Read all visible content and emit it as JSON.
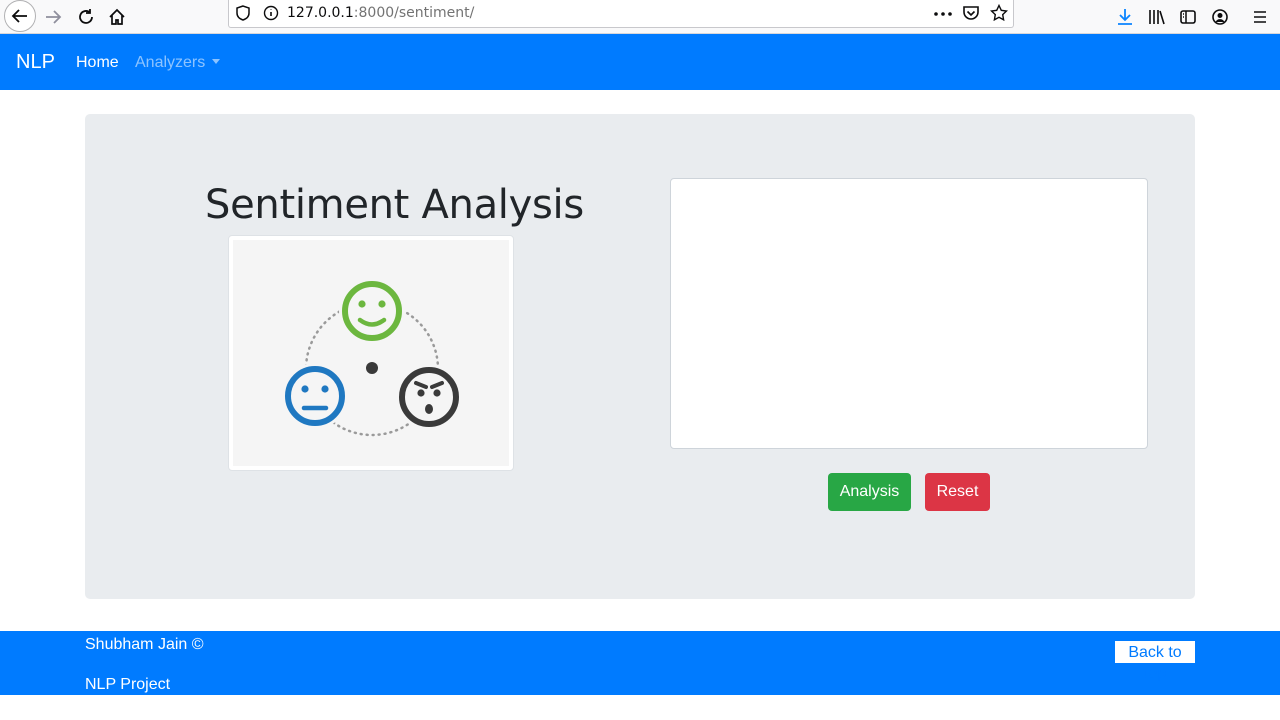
{
  "browser": {
    "url_host": "127.0.0.1",
    "url_rest": ":8000/sentiment/",
    "icons": [
      "back-arrow-icon",
      "forward-arrow-icon",
      "reload-icon",
      "home-icon",
      "shield-icon",
      "info-icon",
      "more-icon",
      "pocket-icon",
      "bookmark-star-icon",
      "download-icon",
      "library-icon",
      "sidebar-icon",
      "account-icon",
      "menu-icon"
    ]
  },
  "navbar": {
    "brand": "NLP",
    "home_label": "Home",
    "analyzers_label": "Analyzers"
  },
  "main": {
    "title": "Sentiment Analysis",
    "textarea_value": "",
    "analysis_label": "Analysis",
    "reset_label": "Reset"
  },
  "footer": {
    "author": "Shubham Jain ©",
    "project": "NLP Project",
    "back_to_top": "Back to top"
  },
  "colors": {
    "primary": "#007bff",
    "success": "#28a745",
    "danger": "#dc3545",
    "jumbotron": "#e9ecef",
    "happy": "#6cb73f",
    "neutral": "#1f78c1",
    "angry": "#3a3a3a"
  }
}
